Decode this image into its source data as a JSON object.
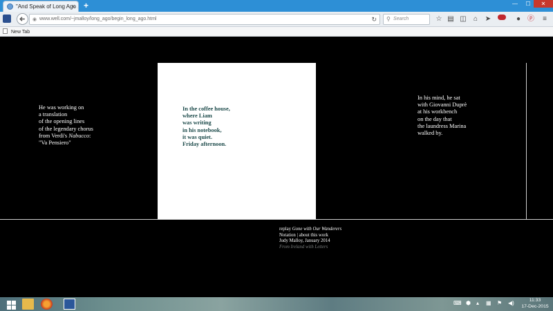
{
  "browser": {
    "tab_title": "\"And Speak of Long Ago ...",
    "tab_close": "×",
    "new_tab_glyph": "+",
    "window_controls": {
      "minimize": "—",
      "maximize": "☐",
      "close": "✕"
    },
    "url": "www.well.com/~jmalloy/long_ago/begin_long_ago.html",
    "search_placeholder": "Search",
    "bookmark_label": "New Tab",
    "nav_icons": [
      "star-icon",
      "clipboard-icon",
      "pocket-icon",
      "home-icon",
      "send-icon",
      "extension-icon",
      "chat-icon",
      "pinterest-icon",
      "menu-icon"
    ]
  },
  "page": {
    "left_poem": "He was working on\na translation\nof the opening lines\nof the legendary chorus\nfrom Verdi's Nabucco:\n\"Va Pensiero\"",
    "center_poem": "In the coffee house,\nwhere Liam\nwas writing\nin his notebook,\nit was quiet.\nFriday afternoon.",
    "right_poem": "In his mind, he sat\nwith Giovanni Duprè\nat his workbench\non the day that\nthe laundress Marina\nwalked by.",
    "footer": {
      "replay_prefix": "replay ",
      "replay_title": "Gone with Our Wanderers",
      "notation": "Notation",
      "separator": " | ",
      "about": "about this work",
      "author_line": "Judy Malloy, January 2014",
      "from_line": "From Ireland with Letters"
    }
  },
  "taskbar": {
    "time": "11:33",
    "date": "17-Dec-2015"
  },
  "colors": {
    "page_bg": "#000000",
    "center_panel": "#ffffff",
    "center_text": "#1c4a4a",
    "tab_strip": "#2d8fd6"
  }
}
